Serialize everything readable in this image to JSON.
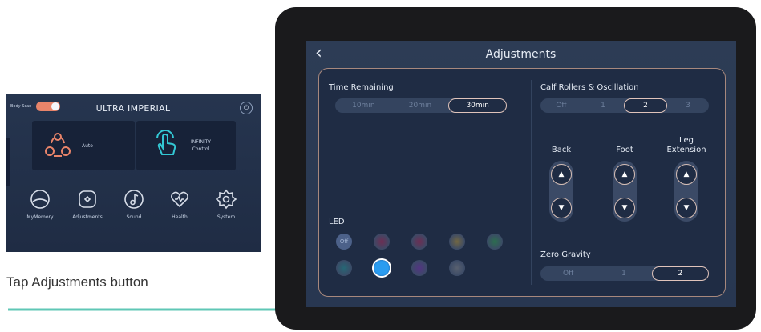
{
  "home": {
    "body_scan_label": "Body Scan",
    "title": "ULTRA IMPERIAL",
    "auto_label": "Auto",
    "infinity_label_line1": "INFINITY",
    "infinity_label_line2": "Control",
    "menu": [
      "MyMemory",
      "Adjustments",
      "Sound",
      "Health",
      "System"
    ],
    "colors": {
      "accent": "#e8846a",
      "icon": "#33c8d4"
    }
  },
  "caption": "Tap Adjustments button",
  "adjustments": {
    "title": "Adjustments",
    "time_remaining": {
      "label": "Time Remaining",
      "options": [
        "10min",
        "20min",
        "30min"
      ],
      "selected": "30min"
    },
    "calf": {
      "label": "Calf Rollers & Oscillation",
      "options": [
        "Off",
        "1",
        "2",
        "3"
      ],
      "selected": "2"
    },
    "back": {
      "label": "Back"
    },
    "foot": {
      "label": "Foot"
    },
    "leg": {
      "label_line1": "Leg",
      "label_line2": "Extension"
    },
    "led": {
      "label": "LED",
      "off_label": "Off",
      "selected_index": 6,
      "colors": [
        "#e0306a",
        "#e0306a",
        "#f0c040",
        "#40d060",
        "#30c0c0",
        "#2a9cf0",
        "#a040e0",
        "#b0b0b0"
      ]
    },
    "zero_gravity": {
      "label": "Zero Gravity",
      "options": [
        "Off",
        "1",
        "2"
      ],
      "selected": "2"
    }
  }
}
